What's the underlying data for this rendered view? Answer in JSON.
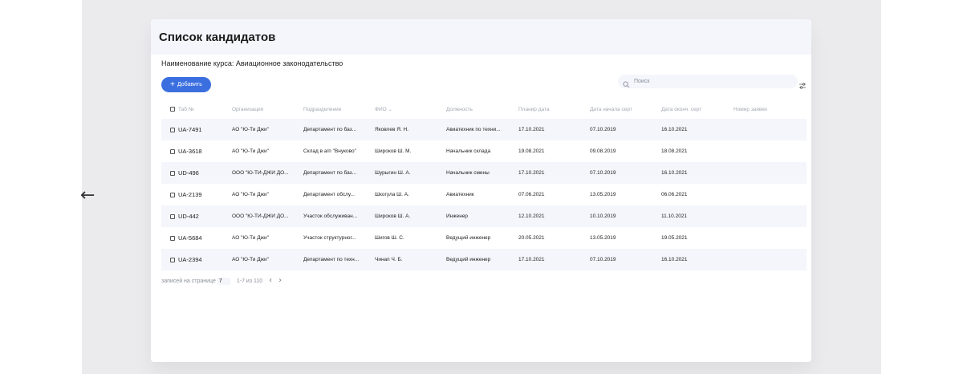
{
  "page": {
    "back_icon": "arrow-left-icon",
    "title": "Список кандидатов",
    "course_label": "Наименование курса: Авиационное законодательство"
  },
  "toolbar": {
    "add_label": "Добавить",
    "add_icon": "plus-icon",
    "search_placeholder": "Поиск",
    "search_icon": "search-icon",
    "filter_icon": "filter-sliders-icon",
    "accent": "#3b6fe0"
  },
  "table": {
    "columns": [
      "Таб №",
      "Организация",
      "Подразделение",
      "ФИО",
      "Должность",
      "Планир дата",
      "Дата начала серт",
      "Дата оконч. серт",
      "Номер заявки"
    ],
    "sort_column": "ФИО",
    "rows": [
      [
        "UA-7491",
        "АО \"Ю-Ти Джи\"",
        "Департамент по баз...",
        "Яковлев Я. Н.",
        "Авиатехник по техни...",
        "17.10.2021",
        "07.10.2019",
        "16.10.2021",
        ""
      ],
      [
        "UA-3618",
        "АО \"Ю-Ти Джи\"",
        "Склад в а/п \"Внуково\"",
        "Широков Ш. М.",
        "Начальник склада",
        "19.08.2021",
        "09.08.2019",
        "18.08.2021",
        ""
      ],
      [
        "UD-496",
        "ООО \"Ю-ТИ-ДЖИ ДО...",
        "Департамент по баз...",
        "Шурыгин Ш. А.",
        "Начальник смены",
        "17.10.2021",
        "07.10.2019",
        "16.10.2021",
        ""
      ],
      [
        "UA-2139",
        "АО \"Ю-Ти Джи\"",
        "Департамент обслу...",
        "Шкогула Ш. А.",
        "Авиатехник",
        "07.06.2021",
        "13.05.2019",
        "06.06.2021",
        ""
      ],
      [
        "UD-442",
        "ООО \"Ю-ТИ-ДЖИ ДО...",
        "Участок обслуживан...",
        "Широков Ш. А.",
        "Инженер",
        "12.10.2021",
        "10.10.2019",
        "11.10.2021",
        ""
      ],
      [
        "UA-5684",
        "АО \"Ю-Ти Джи\"",
        "Участок структурног...",
        "Шигов Ш. С.",
        "Ведущий инженер",
        "20.05.2021",
        "13.05.2019",
        "19.05.2021",
        ""
      ],
      [
        "UA-2394",
        "АО \"Ю-Ти Джи\"",
        "Департамент по техн...",
        "Чинап Ч. Б.",
        "Ведущий инженер",
        "17.10.2021",
        "07.10.2019",
        "16.10.2021",
        ""
      ]
    ]
  },
  "pagination": {
    "per_page_label": "записей на странице",
    "per_page_value": "7",
    "range": "1-7 из 110",
    "prev_icon": "chevron-left-icon",
    "next_icon": "chevron-right-icon"
  }
}
